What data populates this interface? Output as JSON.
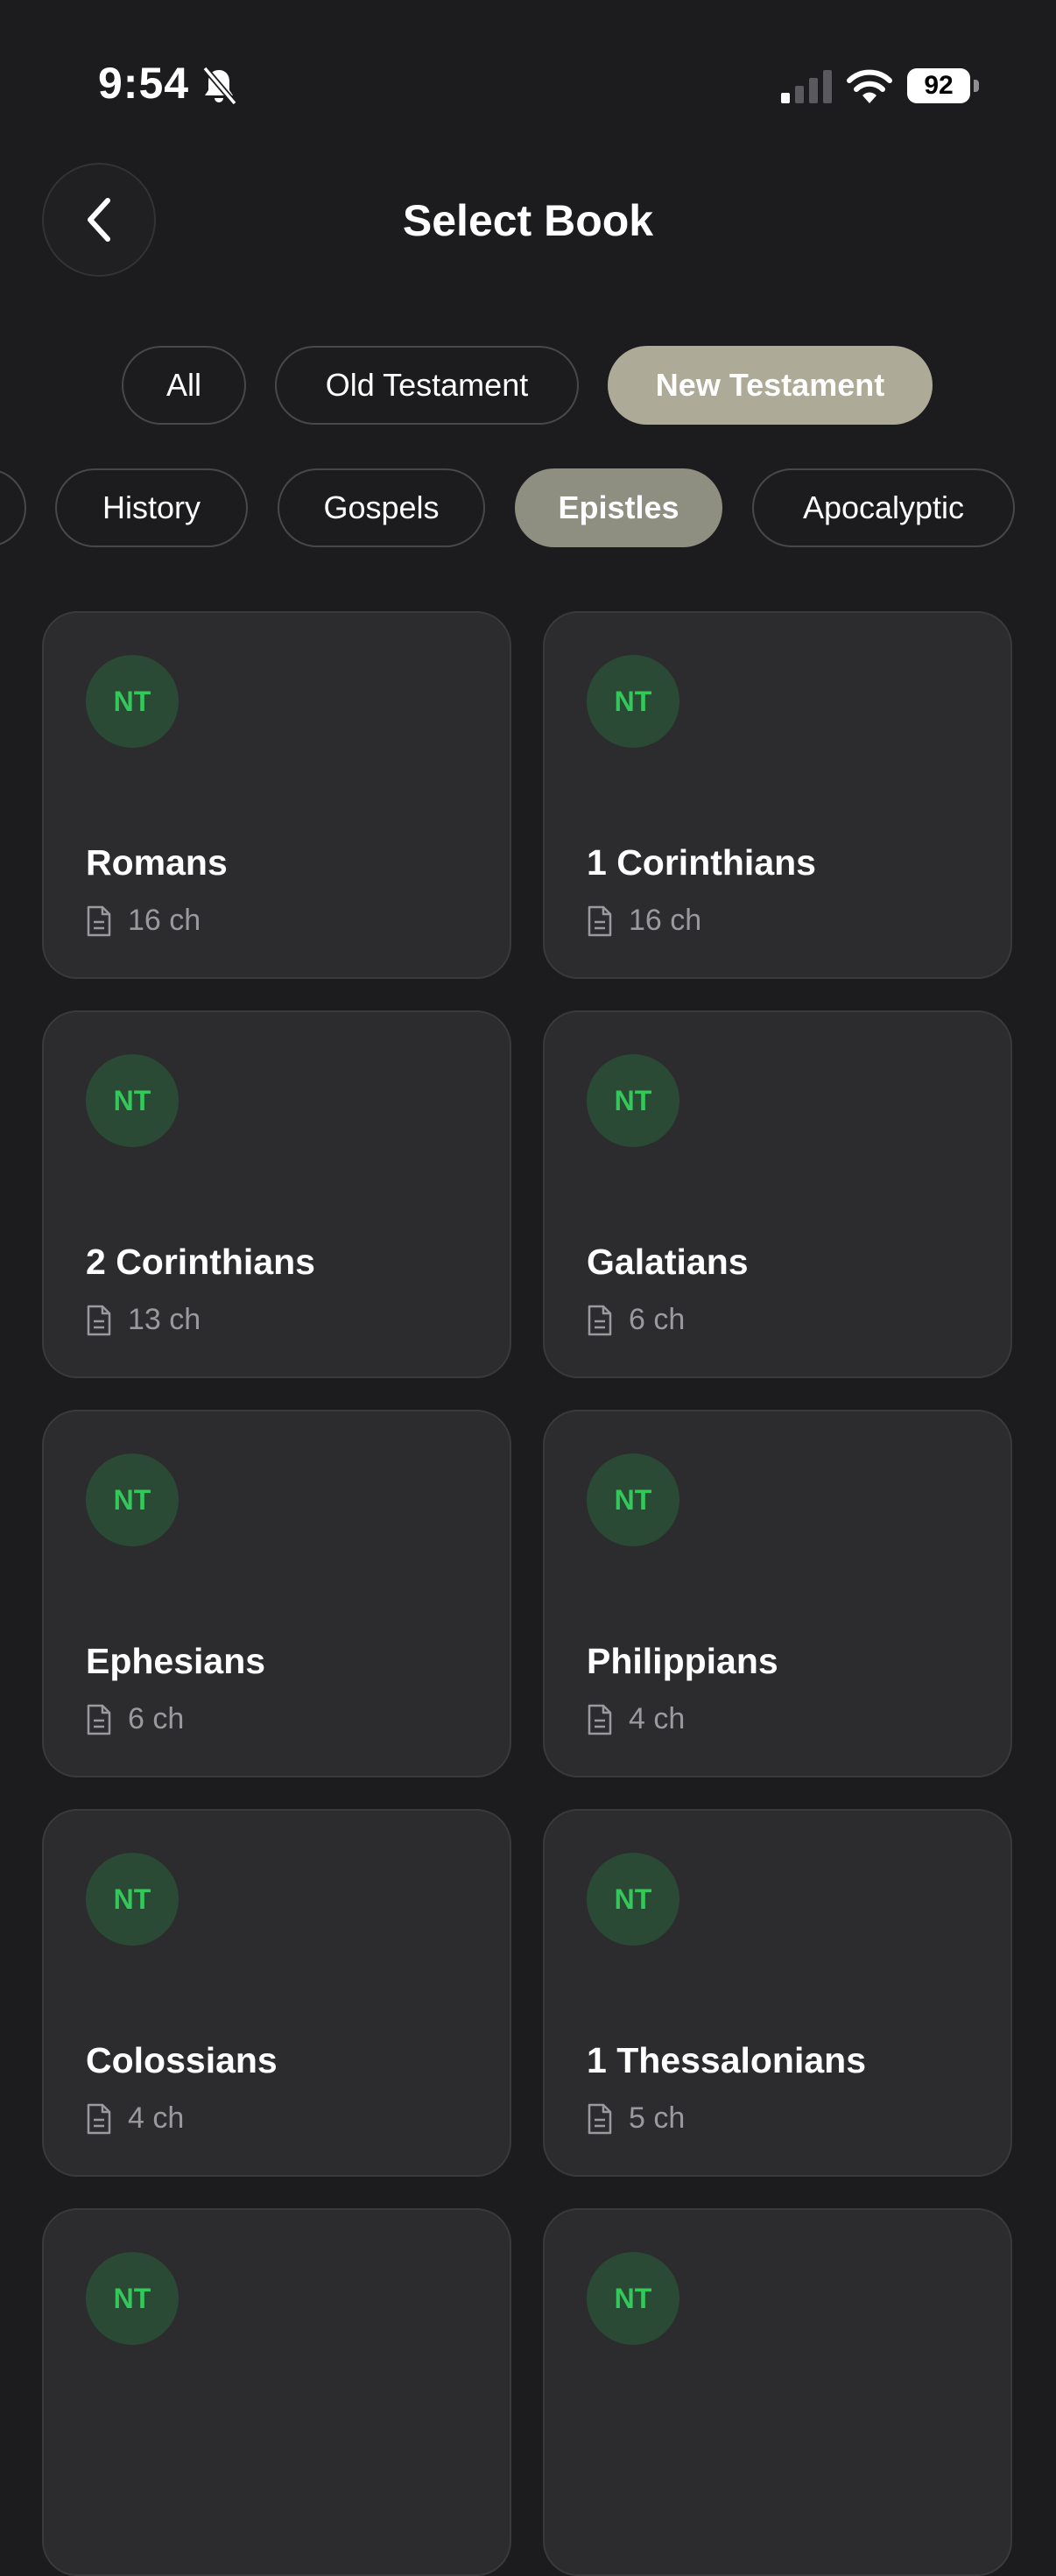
{
  "status": {
    "time": "9:54",
    "battery": "92"
  },
  "header": {
    "title": "Select Book"
  },
  "testament_filters": [
    {
      "label": "All"
    },
    {
      "label": "Old Testament"
    },
    {
      "label": "New Testament",
      "active": true
    }
  ],
  "genre_filters": [
    {
      "label": "History"
    },
    {
      "label": "Gospels"
    },
    {
      "label": "Epistles",
      "active": true
    },
    {
      "label": "Apocalyptic"
    }
  ],
  "books": [
    {
      "badge": "NT",
      "name": "Romans",
      "chapters": "16 ch"
    },
    {
      "badge": "NT",
      "name": "1 Corinthians",
      "chapters": "16 ch"
    },
    {
      "badge": "NT",
      "name": "2 Corinthians",
      "chapters": "13 ch"
    },
    {
      "badge": "NT",
      "name": "Galatians",
      "chapters": "6 ch"
    },
    {
      "badge": "NT",
      "name": "Ephesians",
      "chapters": "6 ch"
    },
    {
      "badge": "NT",
      "name": "Philippians",
      "chapters": "4 ch"
    },
    {
      "badge": "NT",
      "name": "Colossians",
      "chapters": "4 ch"
    },
    {
      "badge": "NT",
      "name": "1 Thessalonians",
      "chapters": "5 ch"
    },
    {
      "badge": "NT"
    },
    {
      "badge": "NT"
    }
  ],
  "colors": {
    "background": "#1c1c1e",
    "card": "#2c2c2e",
    "badge_bg": "#2b4a35",
    "badge_text": "#34c759",
    "active_testament_chip": "#adab97",
    "active_genre_chip": "#8f8f81"
  }
}
